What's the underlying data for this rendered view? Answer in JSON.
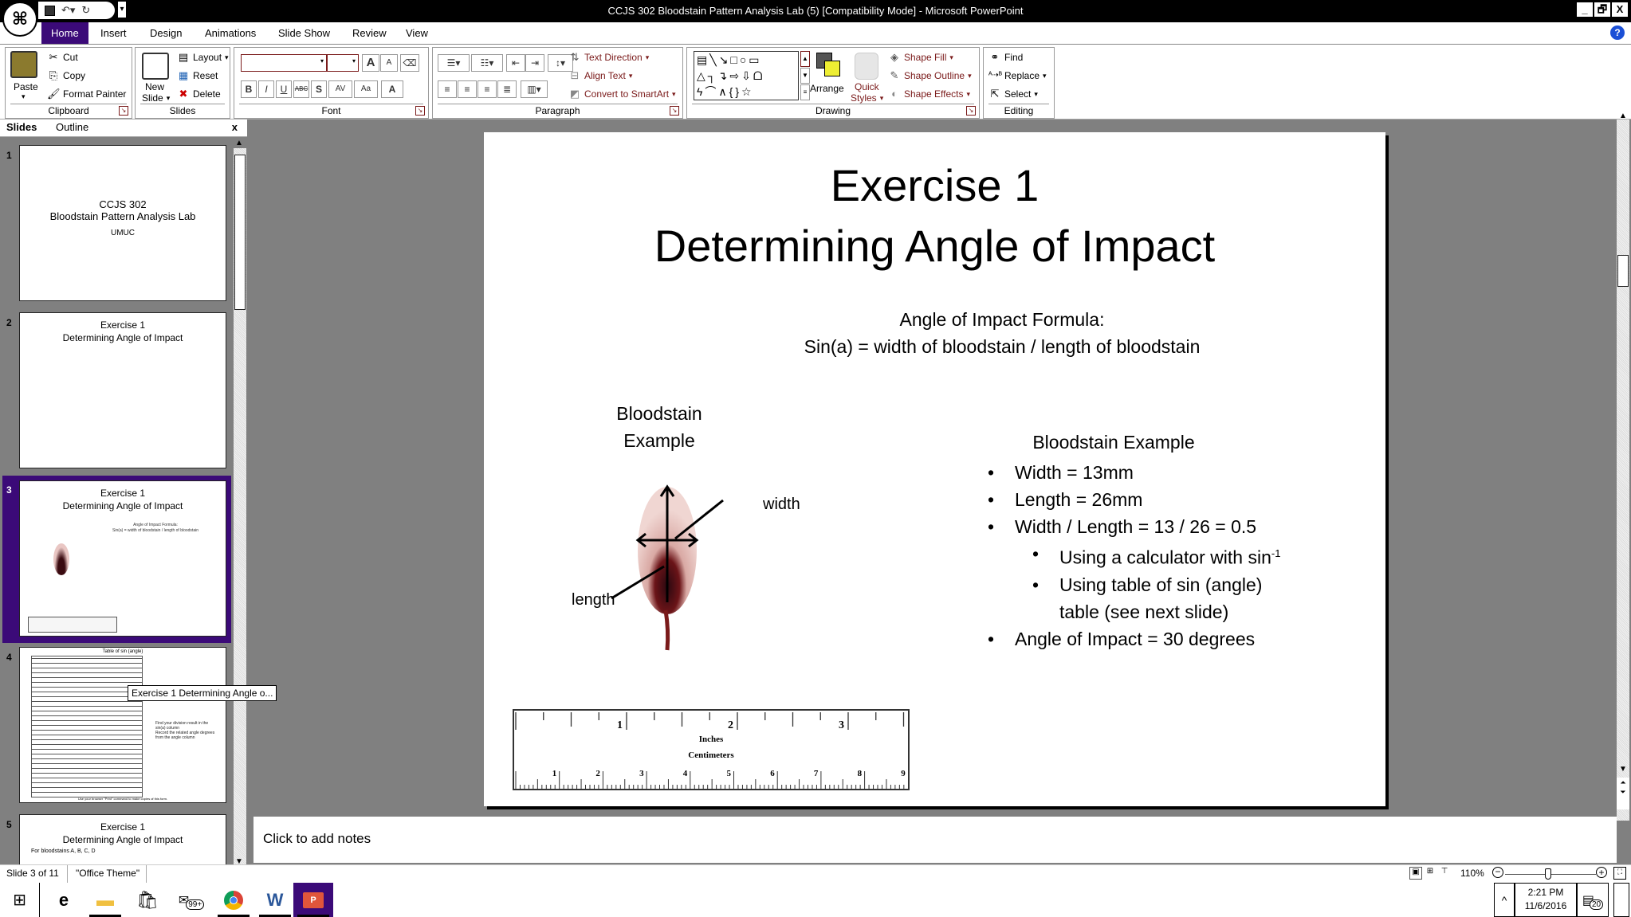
{
  "window": {
    "title": "CCJS 302 Bloodstain Pattern Analysis Lab (5) [Compatibility Mode] - Microsoft PowerPoint",
    "controls": {
      "minimize": "_",
      "restore": "🗗",
      "close": "X"
    }
  },
  "quick_access": {
    "save": "save-icon",
    "undo": "undo-icon",
    "redo": "redo-icon",
    "customize": "▾"
  },
  "tabs": [
    {
      "label": "Home",
      "active": true
    },
    {
      "label": "Insert"
    },
    {
      "label": "Design"
    },
    {
      "label": "Animations"
    },
    {
      "label": "Slide Show"
    },
    {
      "label": "Review"
    },
    {
      "label": "View"
    }
  ],
  "ribbon": {
    "clipboard": {
      "label": "Clipboard",
      "paste": "Paste",
      "cut": "Cut",
      "copy": "Copy",
      "format_painter": "Format Painter"
    },
    "slides": {
      "label": "Slides",
      "new_slide_1": "New",
      "new_slide_2": "Slide",
      "layout": "Layout",
      "reset": "Reset",
      "delete": "Delete"
    },
    "font": {
      "label": "Font",
      "font_name": "",
      "font_size": "",
      "grow": "A",
      "shrink": "A",
      "bold": "B",
      "italic": "I",
      "underline": "U",
      "strike": "ABC",
      "shadow": "S",
      "spacing": "AV",
      "case": "Aa",
      "color": "A"
    },
    "paragraph": {
      "label": "Paragraph",
      "text_direction": "Text Direction",
      "align_text": "Align Text",
      "convert_smartart": "Convert to SmartArt"
    },
    "drawing": {
      "label": "Drawing",
      "arrange": "Arrange",
      "quick_styles_1": "Quick",
      "quick_styles_2": "Styles",
      "shape_fill": "Shape Fill",
      "shape_outline": "Shape Outline",
      "shape_effects": "Shape Effects",
      "shapes_row1": "▤╲↘□○▭",
      "shapes_row2": "△┐↴⇨⇩ᗝ",
      "shapes_row3": "ϟ⌒∧{}☆"
    },
    "editing": {
      "label": "Editing",
      "find": "Find",
      "replace": "Replace",
      "select": "Select"
    }
  },
  "slides_panel": {
    "tab_slides": "Slides",
    "tab_outline": "Outline",
    "close": "x",
    "thumbnails": [
      {
        "num": "1",
        "lines": [
          "CCJS 302",
          "Bloodstain Pattern Analysis Lab"
        ],
        "sub": "UMUC"
      },
      {
        "num": "2",
        "lines": [
          "Exercise 1",
          "Determining Angle of Impact"
        ]
      },
      {
        "num": "3",
        "lines": [
          "Exercise 1",
          "Determining Angle of Impact"
        ],
        "selected": true
      },
      {
        "num": "4",
        "title": "Table of sin (angle)",
        "bullets": [
          "Find your division result in the sin(a) column",
          "Record the related angle degrees from the angle column"
        ],
        "footer": "Use your browser \"Print\" command to make copies of this form."
      },
      {
        "num": "5",
        "lines": [
          "Exercise 1",
          "Determining Angle of Impact"
        ],
        "bullet": "For bloodstains A, B, C, D"
      }
    ],
    "tooltip": "Exercise 1 Determining Angle o..."
  },
  "slide": {
    "title_line1": "Exercise 1",
    "title_line2": "Determining Angle of Impact",
    "formula_heading": "Angle of Impact Formula:",
    "formula": "Sin(a) = width of bloodstain / length of bloodstain",
    "image_caption_1": "Bloodstain",
    "image_caption_2": "Example",
    "label_width": "width",
    "label_length": "length",
    "example_heading": "Bloodstain Example",
    "bullets": [
      {
        "text": "Width = 13mm",
        "level": 1
      },
      {
        "text": "Length = 26mm",
        "level": 1
      },
      {
        "text": "Width / Length = 13 / 26 = 0.5",
        "level": 1
      },
      {
        "text": "Using a calculator with sin",
        "sup": "-1",
        "level": 2
      },
      {
        "text": "Using table of sin (angle)",
        "level": 2
      },
      {
        "text": "table (see next slide)",
        "level": 2,
        "continuation": true
      },
      {
        "text": "Angle of Impact = 30 degrees",
        "level": 1
      }
    ],
    "ruler": {
      "inches_label": "Inches",
      "cm_label": "Centimeters",
      "inch_marks": [
        "1",
        "2",
        "3"
      ],
      "cm_marks": [
        "1",
        "2",
        "3",
        "4",
        "5",
        "6",
        "7",
        "8",
        "9"
      ]
    }
  },
  "notes": {
    "placeholder": "Click to add notes"
  },
  "status_bar": {
    "slide_info": "Slide 3 of 11",
    "theme": "\"Office Theme\"",
    "zoom": "110%",
    "zoom_minus": "−",
    "zoom_plus": "+"
  },
  "taskbar": {
    "time": "2:21 PM",
    "date": "11/6/2016",
    "notification_count": "20",
    "badge": "99+",
    "chevron": "^"
  }
}
